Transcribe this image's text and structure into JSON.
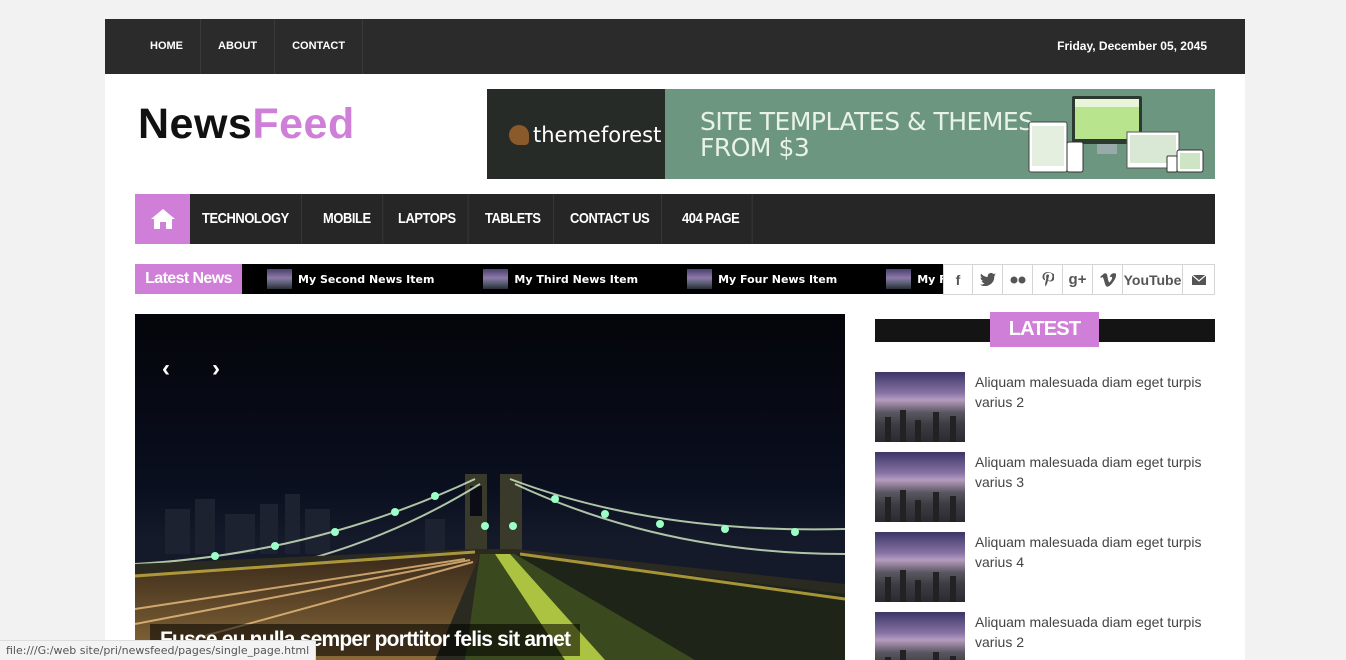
{
  "top_nav": {
    "items": [
      "HOME",
      "ABOUT",
      "CONTACT"
    ],
    "date": "Friday, December 05, 2045"
  },
  "logo": {
    "part1": "News",
    "part2": "Feed"
  },
  "banner": {
    "brand": "themeforest",
    "line1": "SITE TEMPLATES & THEMES",
    "line2": "FROM $3"
  },
  "main_nav": {
    "items": [
      "TECHNOLOGY",
      "MOBILE",
      "LAPTOPS",
      "TABLETS",
      "CONTACT US",
      "404 PAGE"
    ]
  },
  "ticker": {
    "label": "Latest News",
    "items": [
      "My Second News Item",
      "My Third News Item",
      "My Four News Item",
      "My Five News Item"
    ]
  },
  "social": {
    "icons": [
      "facebook-icon",
      "twitter-icon",
      "flickr-icon",
      "pinterest-icon",
      "google-plus-icon",
      "vimeo-icon",
      "youtube-icon",
      "mail-icon"
    ],
    "youtube_label": "YouTube"
  },
  "slider": {
    "caption": "Fusce eu nulla semper porttitor felis sit amet"
  },
  "sidebar": {
    "title": "LATEST POST",
    "posts": [
      "Aliquam malesuada diam eget turpis varius 2",
      "Aliquam malesuada diam eget turpis varius 3",
      "Aliquam malesuada diam eget turpis varius 4",
      "Aliquam malesuada diam eget turpis varius 2"
    ]
  },
  "status_bar": {
    "url": "file:///G:/web site/pri/newsfeed/pages/single_page.html"
  },
  "colors": {
    "accent": "#cf7fd7",
    "dark": "#2b2b2b"
  }
}
